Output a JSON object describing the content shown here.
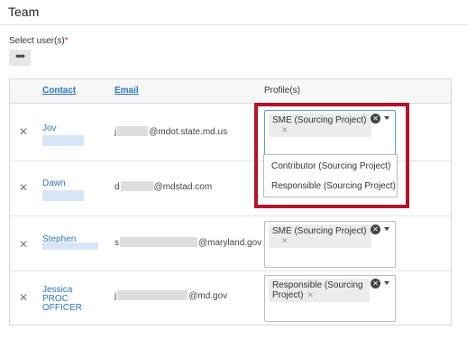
{
  "header": {
    "title": "Team"
  },
  "selector": {
    "label": "Select user(s)",
    "required_mark": "*",
    "more_button": "•••"
  },
  "table": {
    "columns": {
      "contact": "Contact",
      "email": "Email",
      "profiles": "Profile(s)"
    },
    "remove_glyph": "✕",
    "rows": [
      {
        "contact": "Jov",
        "email_prefix": "j",
        "email_domain": "@mdot.state.md.us",
        "profile": "SME (Sourcing Project)",
        "profile_remove": "✕"
      },
      {
        "contact": "Dawn",
        "email_prefix": "d",
        "email_domain": "@mdstad.com",
        "profile": "",
        "profile_remove": ""
      },
      {
        "contact": "Stephen",
        "email_prefix": "s",
        "email_domain": "@maryland.gov",
        "profile": "SME (Sourcing Project)",
        "profile_remove": "✕"
      },
      {
        "contact": "Jessica PROC OFFICER",
        "email_prefix": "j",
        "email_domain": "@md.gov",
        "profile": "Responsible (Sourcing Project)",
        "profile_remove": "✕"
      }
    ]
  },
  "dropdown": {
    "options": [
      "Contributor (Sourcing Project)",
      "Responsible (Sourcing Project)"
    ]
  },
  "icons": {
    "clear": "clear-circle-icon",
    "caret": "chevron-down-icon",
    "remove": "close-icon"
  },
  "colors": {
    "link": "#2a75c4",
    "highlight": "#b3142c",
    "required": "#d2202f"
  }
}
